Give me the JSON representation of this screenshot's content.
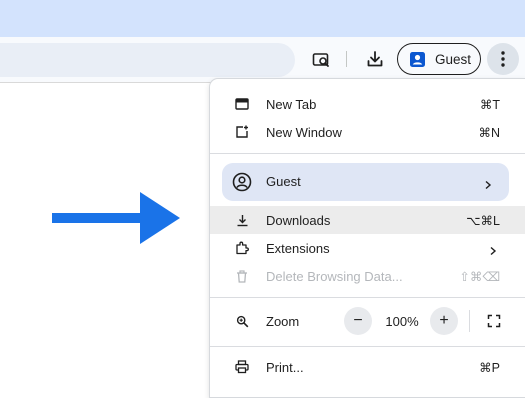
{
  "toolbar": {
    "profile_label": "Guest",
    "icons": [
      "screenshot-search-icon",
      "download-icon",
      "profile-icon",
      "more-vert-icon"
    ]
  },
  "menu": {
    "items": [
      {
        "label": "New Tab",
        "shortcut": "⌘T",
        "icon": "new-tab-icon"
      },
      {
        "label": "New Window",
        "shortcut": "⌘N",
        "icon": "new-window-icon"
      }
    ],
    "guest": {
      "label": "Guest",
      "icon": "account-circle-icon"
    },
    "downloads": {
      "label": "Downloads",
      "shortcut": "⌥⌘L",
      "icon": "download-icon"
    },
    "extensions": {
      "label": "Extensions",
      "icon": "puzzle-icon"
    },
    "delete_data": {
      "label": "Delete Browsing Data...",
      "shortcut": "⇧⌘⌫",
      "icon": "trash-icon",
      "disabled": true
    },
    "zoom": {
      "label": "Zoom",
      "minus": "−",
      "value": "100%",
      "plus": "+",
      "icon": "zoom-icon"
    },
    "print": {
      "label": "Print...",
      "shortcut": "⌘P",
      "icon": "print-icon"
    }
  },
  "colors": {
    "tabstrip": "#d3e3fd",
    "arrow": "#1a73e8",
    "guest_highlight": "#dfe6f5",
    "hover": "#ececec"
  }
}
